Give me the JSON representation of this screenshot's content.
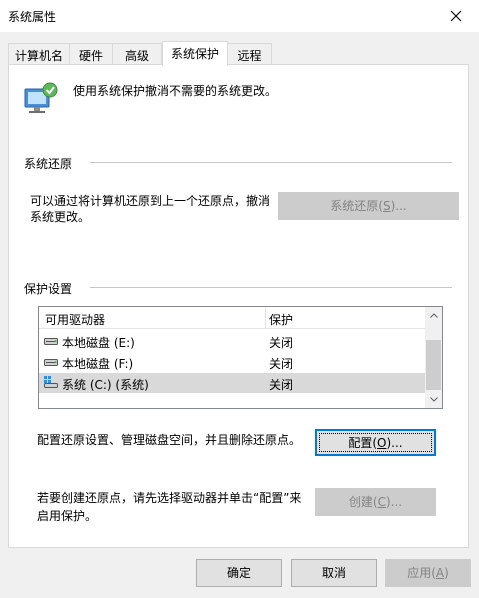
{
  "window": {
    "title": "系统属性"
  },
  "tabs": [
    {
      "label": "计算机名"
    },
    {
      "label": "硬件"
    },
    {
      "label": "高级"
    },
    {
      "label": "系统保护",
      "active": true
    },
    {
      "label": "远程"
    }
  ],
  "intro": {
    "text": "使用系统保护撤消不需要的系统更改。",
    "icon": "system-protection-icon"
  },
  "restore": {
    "group_label": "系统还原",
    "description_line1": "可以通过将计算机还原到上一个还原点，撤消",
    "description_line2": "系统更改。",
    "button": {
      "label_pre": "系统还原(",
      "label_key": "S",
      "label_post": ")...",
      "enabled": false
    }
  },
  "protection": {
    "group_label": "保护设置",
    "columns": [
      "可用驱动器",
      "保护"
    ],
    "drives": [
      {
        "name": "本地磁盘 (E:)",
        "status": "关闭",
        "icon": "hard-drive-icon",
        "selected": false
      },
      {
        "name": "本地磁盘 (F:)",
        "status": "关闭",
        "icon": "hard-drive-icon",
        "selected": false
      },
      {
        "name": "系统 (C:) (系统)",
        "status": "关闭",
        "icon": "system-drive-icon",
        "selected": true
      }
    ],
    "configure_text": "配置还原设置、管理磁盘空间，并且删除还原点。",
    "configure_button": {
      "label_pre": "配置(",
      "label_key": "O",
      "label_post": ")..."
    },
    "create_text_line1": "若要创建还原点，请先选择驱动器并单击“配置”来",
    "create_text_line2": "启用保护。",
    "create_button": {
      "label_pre": "创建(",
      "label_key": "C",
      "label_post": ")...",
      "enabled": false
    }
  },
  "footer": {
    "ok_label": "确定",
    "cancel_label": "取消",
    "apply": {
      "label_pre": "应用(",
      "label_key": "A",
      "label_post": ")",
      "enabled": false
    }
  },
  "colors": {
    "focus_border": "#0078d7",
    "selection": "#d9d9d9",
    "disabled_button": "#cccccc"
  }
}
